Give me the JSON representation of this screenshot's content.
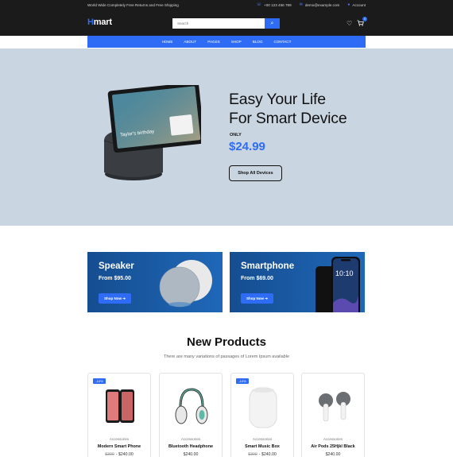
{
  "topbar": {
    "shipping": "World Wide Completely Free Returns and Free Shipping",
    "phone": "+00 123 456 789",
    "email": "demo@example.com",
    "account": "Account"
  },
  "header": {
    "logo_first": "H",
    "logo_rest": "mart",
    "search_placeholder": "Search"
  },
  "cart": {
    "count": "0"
  },
  "nav": {
    "items": [
      {
        "label": "HOME"
      },
      {
        "label": "ABOUT"
      },
      {
        "label": "PAGES"
      },
      {
        "label": "SHOP"
      },
      {
        "label": "BLOG"
      },
      {
        "label": "CONTACT"
      }
    ]
  },
  "hero": {
    "title_line1": "Easy Your Life",
    "title_line2": "For Smart Device",
    "only_label": "ONLY",
    "price": "$24.99",
    "button": "Shop All Devices",
    "device_screen_text": "Taylor's birthday"
  },
  "banners": [
    {
      "title": "Speaker",
      "price": "From $95.00",
      "button": "Shop Now"
    },
    {
      "title": "Smartphone",
      "price": "From $69.00",
      "button": "Shop Now",
      "screen_time": "10:10"
    }
  ],
  "products_section": {
    "title": "New Products",
    "subtitle": "There are many variations of passages of Lorem Ipsum available"
  },
  "products": [
    {
      "badge": "-10%",
      "category": "Accessories",
      "name": "Modern Smart Phone",
      "old_price": "$300",
      "price": "$240.00"
    },
    {
      "badge": "",
      "category": "Accessories",
      "name": "Bluetooth Headphone",
      "old_price": "",
      "price": "$240.00"
    },
    {
      "badge": "-10%",
      "category": "Accessories",
      "name": "Smart Music Box",
      "old_price": "$300",
      "price": "$240.00"
    },
    {
      "badge": "",
      "category": "Accessories",
      "name": "Air Pods 25Hjkl Black",
      "old_price": "",
      "price": "$240.00"
    }
  ],
  "colors": {
    "accent": "#2e6cf6",
    "dark": "#1b1b1b",
    "hero_bg": "#cad5e2",
    "banner": "#1a5ba6"
  }
}
